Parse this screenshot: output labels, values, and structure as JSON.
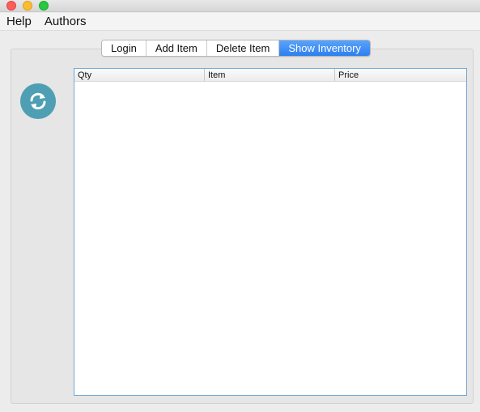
{
  "menu": {
    "items": [
      {
        "label": "Help"
      },
      {
        "label": "Authors"
      }
    ]
  },
  "tabs": [
    {
      "label": "Login",
      "active": false
    },
    {
      "label": "Add Item",
      "active": false
    },
    {
      "label": "Delete Item",
      "active": false
    },
    {
      "label": "Show Inventory",
      "active": true
    }
  ],
  "table": {
    "columns": [
      "Qty",
      "Item",
      "Price"
    ],
    "rows": []
  },
  "colors": {
    "accent": "#2c7ff0",
    "refresh_button": "#4e9fb3",
    "table_border": "#76a7d0"
  },
  "icons": {
    "refresh": "refresh-icon"
  }
}
